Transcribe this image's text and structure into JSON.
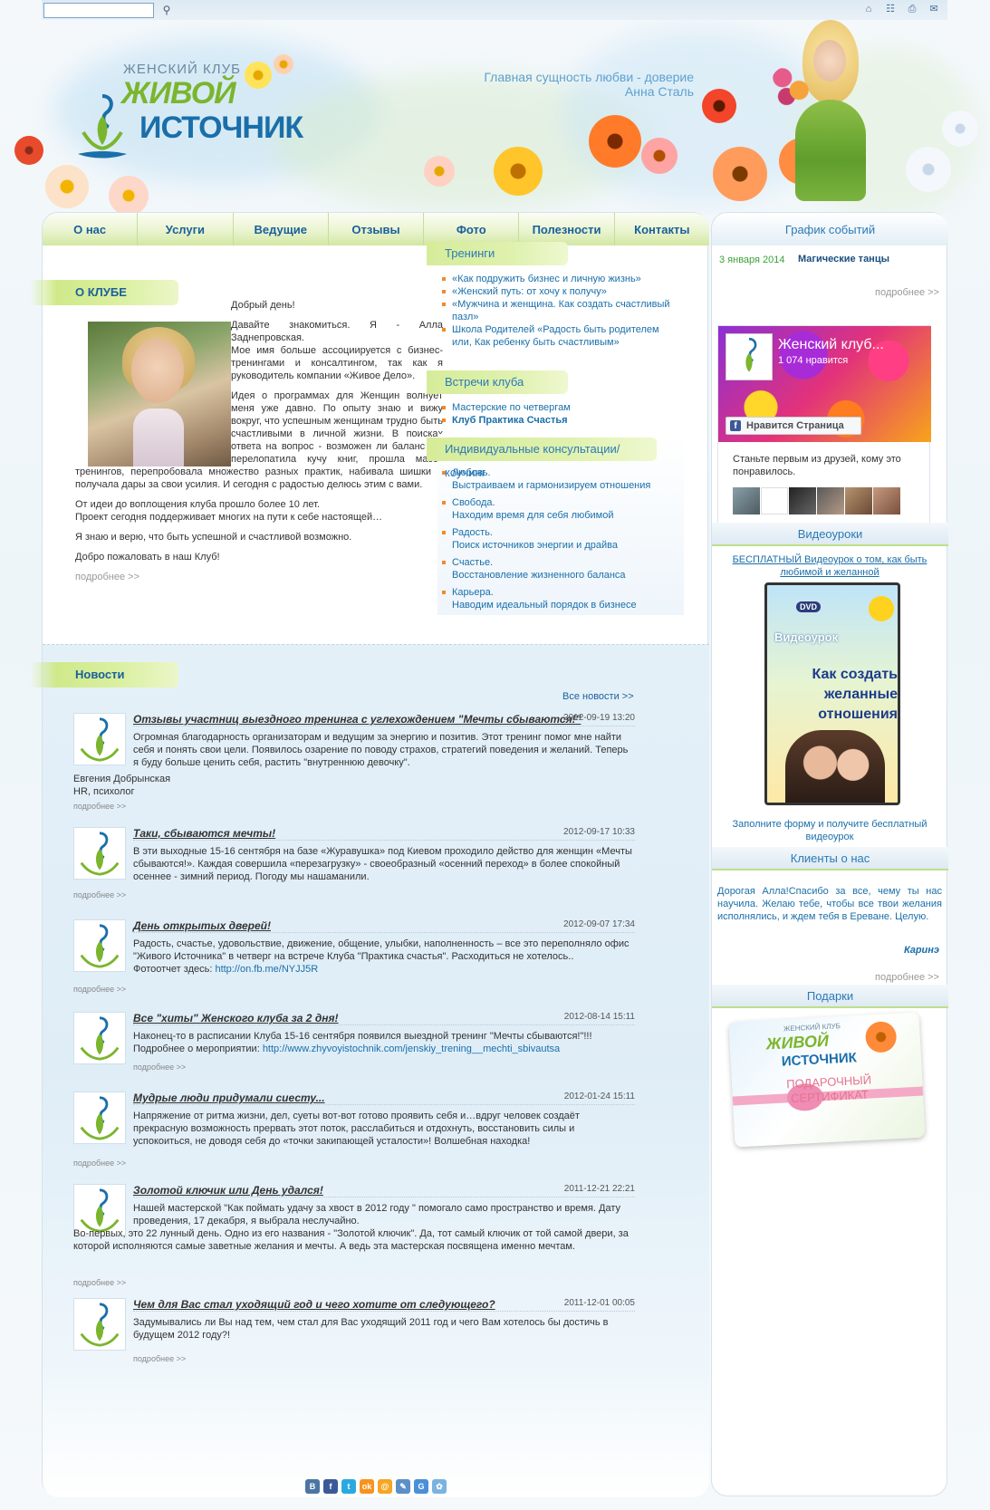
{
  "search": {
    "placeholder": ""
  },
  "toolbar_icons": [
    "home-icon",
    "sitemap-icon",
    "print-icon",
    "mail-icon"
  ],
  "logo": {
    "top": "ЖЕНСКИЙ КЛУБ",
    "line1": "ЖИВОЙ",
    "line2": "ИСТОЧНИК"
  },
  "header_quote": {
    "text": "Главная сущность любви - доверие",
    "author": "Анна Сталь"
  },
  "nav": [
    "О нас",
    "Услуги",
    "Ведущие",
    "Отзывы",
    "Фото",
    "Полезности",
    "Контакты"
  ],
  "about": {
    "heading": "О КЛУБЕ",
    "p1": "Добрый день!",
    "p2": "Давайте знакомиться. Я - Алла Заднепровская.",
    "p3": "Мое имя больше ассоциируется с бизнес-тренингами и консалтингом, так как я руководитель компании «Живое Дело».",
    "p4": "Идея о программах для Женщин волнует меня уже давно. По опыту знаю и вижу вокруг, что успешным женщинам трудно быть счастливыми в личной жизни. В поисках ответа на вопрос - возможен ли баланс - я перелопатила кучу книг, прошла массу тренингов, перепробовала множество разных практик, набивала шишки и получала дары за свои усилия. И сегодня с радостью делюсь этим с вами.",
    "p5": "От идеи до воплощения клуба прошло более 10 лет.",
    "p5b": "Проект сегодня поддерживает многих на пути к себе настоящей…",
    "p6": "Я знаю и верю, что быть успешной и счастливой возможно.",
    "p7": "Добро пожаловать в наш Клуб!",
    "more": "подробнее >>"
  },
  "trainings": {
    "heading": "Тренинги",
    "items": [
      "«Как подружить бизнес и личную жизнь»",
      "«Женский путь: от хочу к получу»",
      "«Мужчина и женщина. Как создать счастливый пазл»",
      "Школа Родителей «Радость быть родителем или, Как ребенку быть счастливым»"
    ]
  },
  "meetings": {
    "heading": "Встречи клуба",
    "items": [
      "Мастерские по четвергам",
      "Клуб Практика Счастья"
    ]
  },
  "consult": {
    "heading": "Индивидуальные консультации/коучинг",
    "items": [
      {
        "t": "Любовь.",
        "s": "Выстраиваем и гармонизируем отношения"
      },
      {
        "t": "Свобода.",
        "s": "Находим время для себя любимой"
      },
      {
        "t": "Радость.",
        "s": "Поиск источников энергии и драйва"
      },
      {
        "t": "Счастье.",
        "s": "Восстановление жизненного баланса"
      },
      {
        "t": "Карьера.",
        "s": "Наводим идеальный порядок в бизнесе"
      }
    ]
  },
  "news": {
    "heading": "Новости",
    "all": "Все новости >>",
    "more": "подробнее >>",
    "items": [
      {
        "title": "Отзывы участниц выездного тренинга с углехождением \"Мечты сбываются!\"",
        "date": "2012-09-19 13:20",
        "body": "Огромная благодарность организаторам и ведущим за энергию и позитив. Этот тренинг помог мне найти себя и понять свои цели. Появилось озарение по поводу страхов, стратегий поведения и желаний. Теперь я буду больше ценить себя, растить \"внутреннюю девочку\".",
        "sig1": "Евгения Добрынская",
        "sig2": "HR, психолог"
      },
      {
        "title": "Таки, сбываются мечты!",
        "date": "2012-09-17 10:33",
        "body": "В эти выходные 15-16 сентября на базе «Журавушка» под Киевом проходило действо для женщин «Мечты сбываются!». Каждая совершила «перезагрузку» - своеобразный «осенний переход» в более спокойный осеннее - зимний период. Погоду мы нашаманили."
      },
      {
        "title": "День открытых дверей!",
        "date": "2012-09-07 17:34",
        "body": "Радость, счастье, удовольствие, движение, общение, улыбки, наполненность – все это переполняло офис \"Живого Источника\" в четверг на встрече Клуба \"Практика счастья\". Расходиться не хотелось..",
        "body2": "Фотоотчет здесь: ",
        "link": "http://on.fb.me/NYJJ5R"
      },
      {
        "title": "Все \"хиты\" Женского клуба за 2 дня!",
        "date": "2012-08-14 15:11",
        "body": "Наконец-то в расписании Клуба 15-16 сентября появился выездной тренинг \"Мечты сбываются!\"!!!",
        "body2": "Подробнее о мероприятии: ",
        "link": "http://www.zhyvoyistochnik.com/jenskiy_trening__mechti_sbivautsa"
      },
      {
        "title": "Мудрые люди придумали сиесту...",
        "date": "2012-01-24 15:11",
        "body": "Напряжение от ритма жизни, дел, суеты вот-вот готово проявить себя и…вдруг человек создаёт прекрасную возможность прервать этот поток, расслабиться и отдохнуть, восстановить силы и успокоиться, не доводя себя до «точки закипающей усталости»! Волшебная находка!"
      },
      {
        "title": "Золотой ключик или День удался!",
        "date": "2011-12-21 22:21",
        "body": "Нашей мастерской \"Как поймать удачу за хвост в 2012 году \" помогало само пространство и время. Дату проведения, 17 декабря, я выбрала неслучайно.",
        "body2": "Во-первых, это 22 лунный день. Одно из его названия - \"Золотой ключик\". Да, тот самый ключик от той самой двери, за которой исполняются самые заветные желания и мечты. А ведь эта мастерская посвящена именно мечтам."
      },
      {
        "title": "Чем для Вас стал уходящий год и чего хотите от следующего?",
        "date": "2011-12-01 00:05",
        "body": "Задумывались ли Вы над тем, чем стал для Вас уходящий 2011 год и чего Вам хотелось бы достичь в будущем 2012 году?!"
      }
    ]
  },
  "social": [
    {
      "label": "В",
      "color": "#4c75a3"
    },
    {
      "label": "f",
      "color": "#3b5998"
    },
    {
      "label": "t",
      "color": "#2aa9e0"
    },
    {
      "label": "ok",
      "color": "#f7931e"
    },
    {
      "label": "@",
      "color": "#f5a623"
    },
    {
      "label": "✎",
      "color": "#5b8fc7"
    },
    {
      "label": "G",
      "color": "#4a90d9"
    },
    {
      "label": "✿",
      "color": "#7ab3e0"
    }
  ],
  "sidebar": {
    "events_heading": "График событий",
    "event_date": "3 января 2014",
    "event_title": "Магические танцы",
    "more": "подробнее >>",
    "fb": {
      "name": "Женский клуб...",
      "likes": "1 074 нравится",
      "like_button": "Нравится Страница",
      "friends": "Станьте первым из друзей, кому это понравилось."
    },
    "video_heading": "Видеоуроки",
    "video_link": "БЕСПЛАТНЫЙ Видеоурок о том, как быть любимой и желанной",
    "dvd": {
      "badge": "DVD",
      "sub": "Видеоурок",
      "title": "Как создать желанные отношения"
    },
    "video_cta": "Заполните форму и получите бесплатный видеоурок",
    "clients_heading": "Клиенты о нас",
    "client_text": "Дорогая Алла!Спасибо за все, чему ты нас научила. Желаю тебе, чтобы все твои желания исполнялись, и ждем тебя в Ереване. Целую.",
    "client_name": "Каринэ",
    "gifts_heading": "Подарки",
    "gift": {
      "l1": "ЖИВОЙ",
      "l2": "ИСТОЧНИК",
      "cert": "ПОДАРОЧНЫЙ СЕРТИФИКАТ",
      "top": "ЖЕНСКИЙ КЛУБ"
    }
  }
}
